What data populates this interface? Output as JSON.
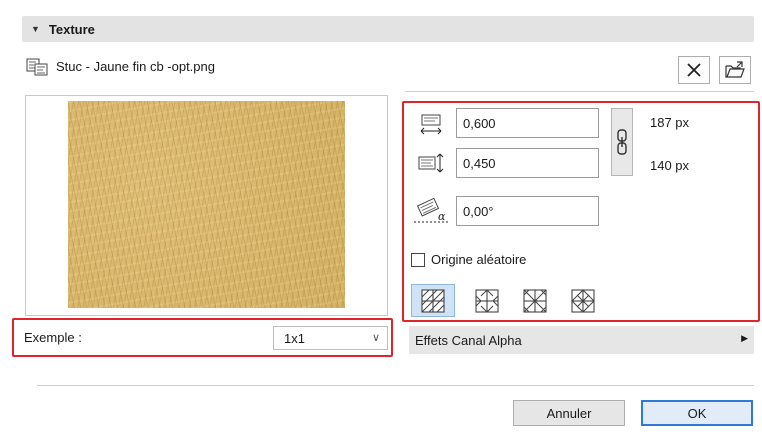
{
  "section": {
    "title": "Texture"
  },
  "file": {
    "name": "Stuc - Jaune fin cb -opt.png",
    "icon": "texture-file-icon"
  },
  "toolbar": {
    "remove_icon": "close-icon",
    "load_icon": "folder-open-icon"
  },
  "sample": {
    "label": "Exemple :",
    "value": "1x1"
  },
  "params": {
    "width_value": "0,600",
    "width_px": "187 px",
    "height_value": "0,450",
    "height_px": "140 px",
    "angle_value": "0,00°",
    "random_origin_label": "Origine aléatoire",
    "random_origin_checked": false,
    "mirror_modes": [
      "mirror-none-icon",
      "mirror-x-icon",
      "mirror-y-icon",
      "mirror-xy-icon"
    ],
    "active_mirror_mode": 0
  },
  "alpha": {
    "label": "Effets Canal Alpha"
  },
  "buttons": {
    "cancel": "Annuler",
    "ok": "OK"
  },
  "colors": {
    "accent": "#2f7ad6",
    "highlight": "#e0242c",
    "texture": "#d7b468"
  }
}
